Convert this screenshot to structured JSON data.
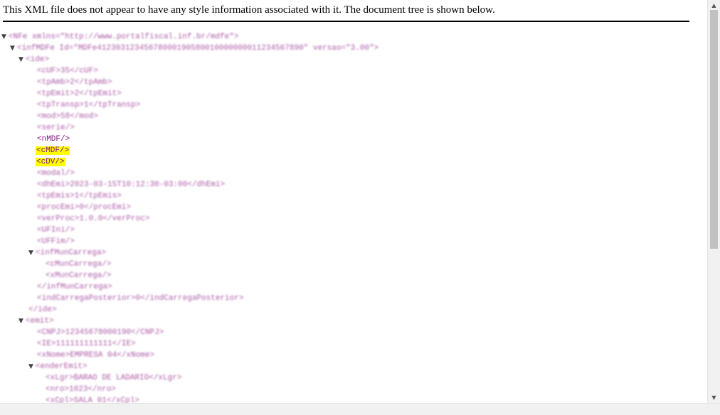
{
  "header": {
    "message": "This XML file does not appear to have any style information associated with it. The document tree is shown below."
  },
  "tree": {
    "toggle_expanded": "▼",
    "lines": [
      {
        "t": "<NFe xmlns=\"http://www.portalfiscal.inf.br/mdfe\">"
      },
      {
        "t": "<infMDFe Id=\"MDFe41230312345678000190580010000000011234567890\" versao=\"3.00\">"
      },
      {
        "t": "<ide>"
      },
      {
        "t": "<cUF>35</cUF>"
      },
      {
        "t": "<tpAmb>2</tpAmb>"
      },
      {
        "t": "<tpEmit>2</tpEmit>"
      },
      {
        "t": "<tpTransp>1</tpTransp>"
      },
      {
        "t": "<mod>58</mod>"
      },
      {
        "t": "<serie/>"
      },
      {
        "t": "<nMDF/>"
      },
      {
        "t": "<cMDF/>"
      },
      {
        "t": "<cDV/>"
      },
      {
        "t": "<modal/>"
      },
      {
        "t": "<dhEmi>2023-03-15T10:12:30-03:00</dhEmi>"
      },
      {
        "t": "<tpEmis>1</tpEmis>"
      },
      {
        "t": "<procEmi>0</procEmi>"
      },
      {
        "t": "<verProc>1.0.0</verProc>"
      },
      {
        "t": "<UFIni/>"
      },
      {
        "t": "<UFFim/>"
      },
      {
        "t": "<infMunCarrega>"
      },
      {
        "t": "<cMunCarrega/>"
      },
      {
        "t": "<xMunCarrega/>"
      },
      {
        "t": "</infMunCarrega>"
      },
      {
        "t": "<indCarregaPosterior>0</indCarregaPosterior>"
      },
      {
        "t": "</ide>"
      },
      {
        "t": "<emit>"
      },
      {
        "t": "<CNPJ>12345678000190</CNPJ>"
      },
      {
        "t": "<IE>111111111111</IE>"
      },
      {
        "t": "<xNome>EMPRESA 04</xNome>"
      },
      {
        "t": "<enderEmit>"
      },
      {
        "t": "<xLgr>BARAO DE LADARIO</xLgr>"
      },
      {
        "t": "<nro>1023</nro>"
      },
      {
        "t": "<xCpl>SALA 01</xCpl>"
      }
    ]
  },
  "scrollbar": {
    "up_arrow": "▲",
    "down_arrow": "▼"
  }
}
